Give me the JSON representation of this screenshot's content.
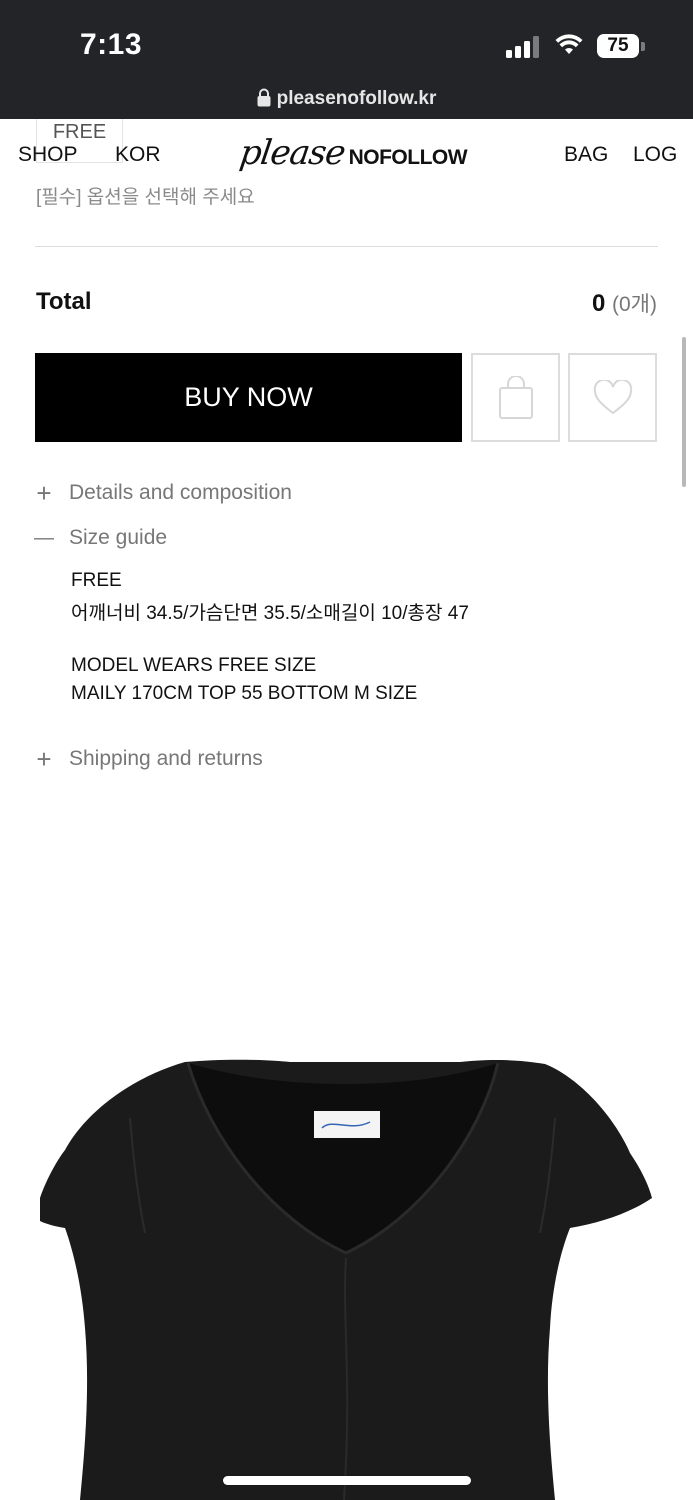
{
  "status_bar": {
    "time": "7:13",
    "battery": "75"
  },
  "browser": {
    "url": "pleasenofollow.kr"
  },
  "header": {
    "free_tag": "FREE",
    "shop": "SHOP",
    "kor": "KOR",
    "logo_script": "please",
    "logo_block": "NOFOLLOW",
    "bag": "BAG",
    "log": "LOG"
  },
  "option": {
    "hint": "[필수] 옵션을 선택해 주세요"
  },
  "total": {
    "label": "Total",
    "amount": "0",
    "count": "(0개)"
  },
  "actions": {
    "buy_now": "BUY NOW"
  },
  "accordion": [
    {
      "sign": "+",
      "label": "Details and composition"
    },
    {
      "sign": "—",
      "label": "Size guide"
    },
    {
      "sign": "+",
      "label": "Shipping and returns"
    }
  ],
  "size_guide": {
    "line1": "FREE",
    "line2": "어깨너비 34.5/가슴단면 35.5/소매길이 10/총장 47",
    "line3": "MODEL WEARS FREE SIZE",
    "line4": "MAILY 170CM TOP 55 BOTTOM M SIZE"
  },
  "colors": {
    "status_bar_bg": "#222427",
    "buy_button_bg": "#000000",
    "muted_text": "#777777"
  },
  "icons": [
    "lock-icon",
    "shopping-bag-icon",
    "heart-icon",
    "plus-icon",
    "minus-icon"
  ]
}
